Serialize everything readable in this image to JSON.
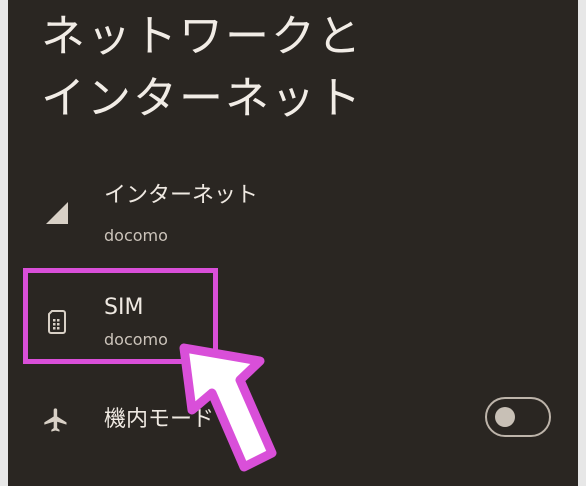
{
  "header": {
    "title_line1": "ネットワークと",
    "title_line2": "インターネット"
  },
  "items": [
    {
      "label": "インターネット",
      "sub": "docomo",
      "icon": "signal-icon"
    },
    {
      "label": "SIM",
      "sub": "docomo",
      "icon": "sim-card-icon"
    },
    {
      "label": "機内モード",
      "icon": "airplane-icon",
      "toggle": "off"
    }
  ],
  "colors": {
    "background": "#2a2622",
    "highlight": "#d94fd9",
    "arrow_outline": "#d94fd9",
    "arrow_fill": "#ffffff"
  }
}
